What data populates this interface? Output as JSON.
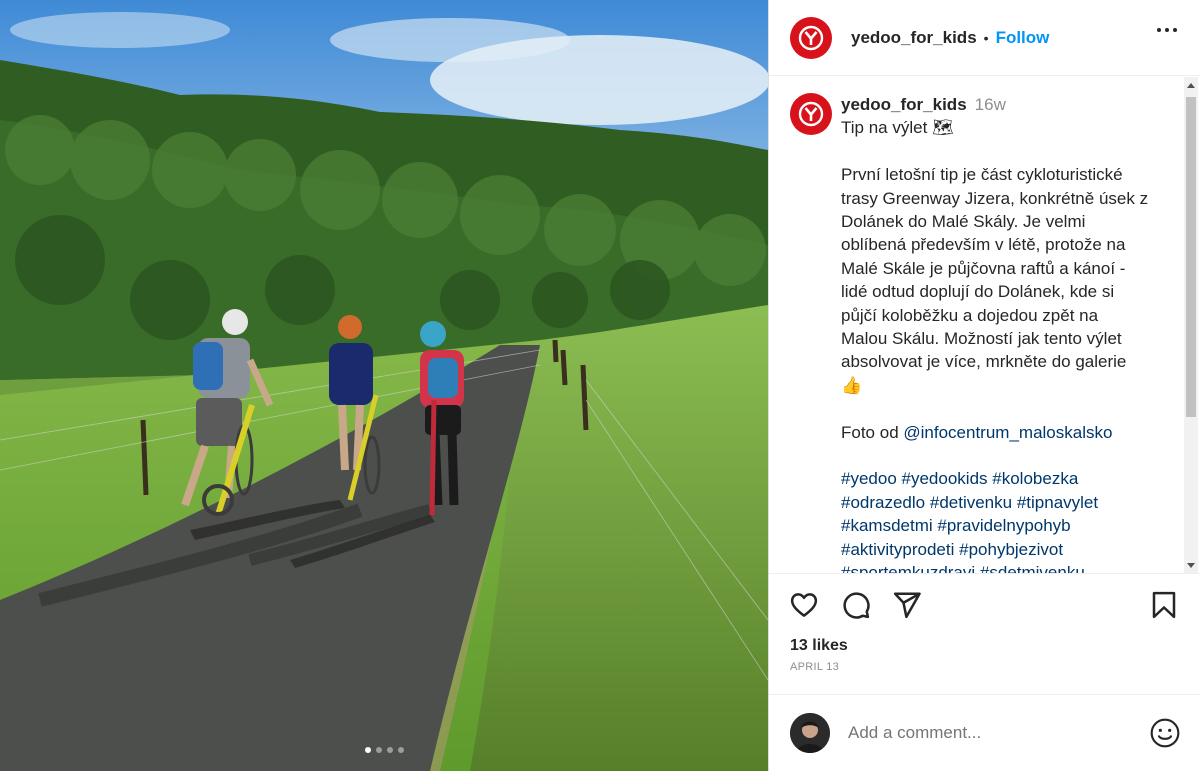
{
  "post": {
    "username": "yedoo_for_kids",
    "separator": "•",
    "follow_label": "Follow",
    "more_icon": "more-horizontal-icon",
    "brand_color": "#d7121a",
    "follow_color": "#0095f6"
  },
  "caption": {
    "username": "yedoo_for_kids",
    "time": "16w",
    "lines": [
      "Tip na výlet 🗺",
      "",
      "První letošní tip je část cykloturistické",
      "trasy Greenway Jizera, konkrétně úsek z",
      "Dolánek do Malé Skály. Je velmi",
      "oblíbená především v létě, protože na",
      "Malé Skále je půjčovna raftů a kánoí -",
      "lidé odtud doplují do Dolánek, kde si",
      "půjčí koloběžku a dojedou zpět na",
      "Malou Skálu. Možností jak tento výlet",
      "absolvovat je více, mrkněte do galerie",
      "👍",
      ""
    ],
    "photo_credit_prefix": "Foto od ",
    "photo_credit_handle": "@infocentrum_maloskalsko",
    "hashtag_lines": [
      "#yedoo #yedookids #kolobezka",
      "#odrazedlo #detivenku #tipnavylet",
      "#kamsdetmi #pravidelnypohyb",
      "#aktivityprodeti #pohybjezivot",
      "#sportemkuzdravi #sdetmivenku"
    ]
  },
  "actions": {
    "like_icon": "heart-icon",
    "comment_icon": "comment-icon",
    "share_icon": "send-icon",
    "save_icon": "bookmark-icon"
  },
  "likes": "13 likes",
  "date": "APRIL 13",
  "comment": {
    "placeholder": "Add a comment...",
    "emoji_icon": "smiley-icon"
  },
  "carousel": {
    "slide_count": 4,
    "active_index": 0
  }
}
